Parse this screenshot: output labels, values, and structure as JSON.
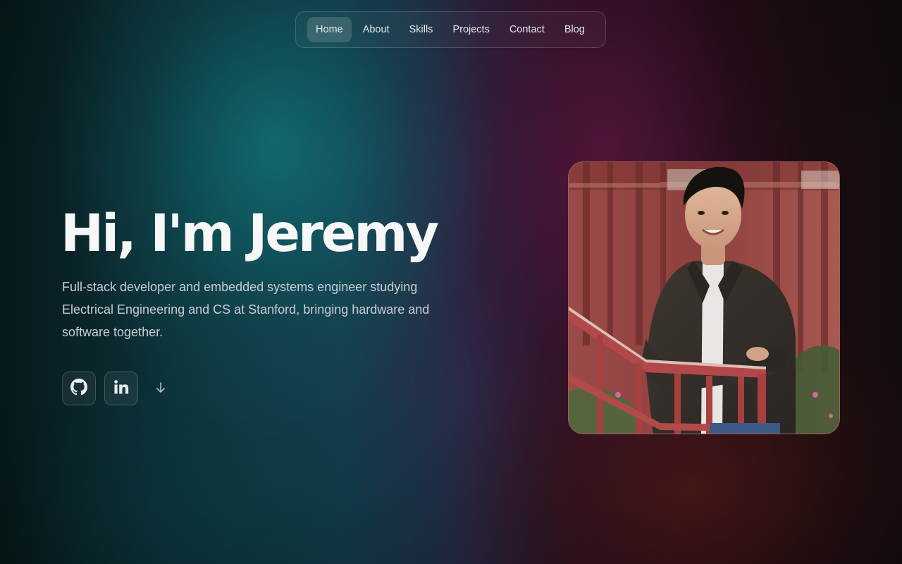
{
  "nav": {
    "items": [
      {
        "label": "Home",
        "active": true
      },
      {
        "label": "About",
        "active": false
      },
      {
        "label": "Skills",
        "active": false
      },
      {
        "label": "Projects",
        "active": false
      },
      {
        "label": "Contact",
        "active": false
      },
      {
        "label": "Blog",
        "active": false
      }
    ]
  },
  "hero": {
    "title": "Hi, I'm Jeremy",
    "subtitle": "Full-stack developer and embedded systems engineer studying Electrical Engineering and CS at Stanford, bringing hardware and software together."
  },
  "social": {
    "icons": [
      "github-icon",
      "linkedin-icon",
      "arrow-down-icon"
    ]
  },
  "photo": {
    "subject": "portrait-photo"
  },
  "colors": {
    "title": "#f7f7f7",
    "subtitle": "#c9cdd2",
    "nav_active_bg": "rgba(255,255,255,0.14)",
    "teal_glow": "#0f6e72",
    "magenta_glow": "#58163c"
  }
}
